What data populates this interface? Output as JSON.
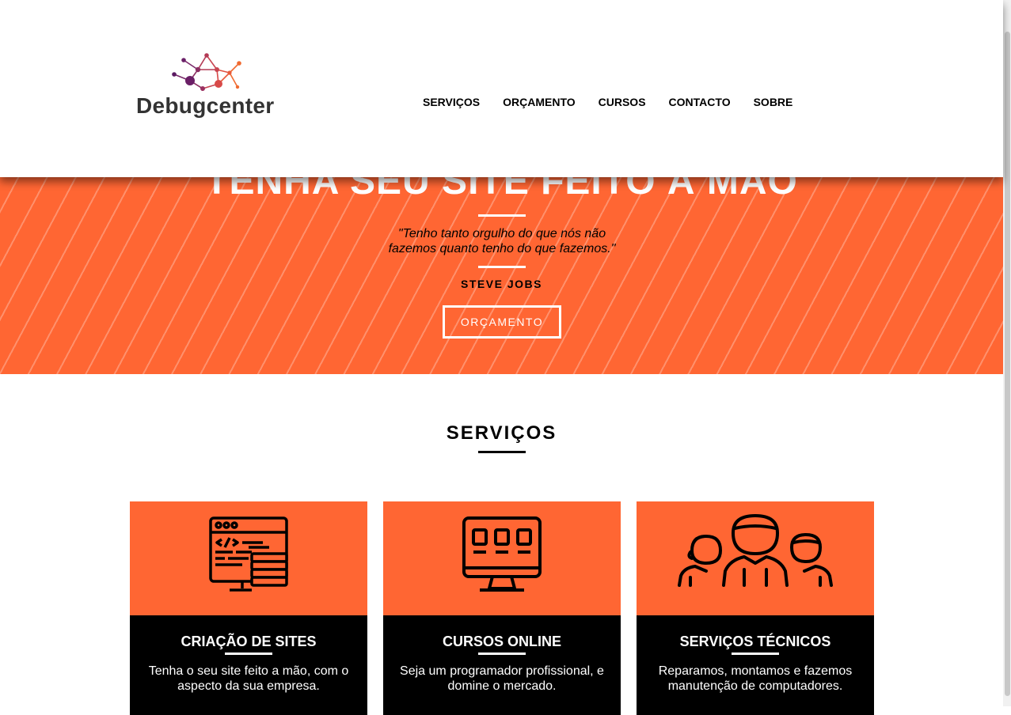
{
  "header": {
    "logo_text": "Debugcenter",
    "nav": [
      "SERVIÇOS",
      "ORÇAMENTO",
      "CURSOS",
      "CONTACTO",
      "SOBRE"
    ]
  },
  "hero": {
    "title": "TENHA SEU SITE FEITO À MÃO",
    "quote_line1": "\"Tenho tanto orgulho do que nós não",
    "quote_line2": "fazemos quanto tenho do que fazemos.\"",
    "author": "STEVE JOBS",
    "button_label": "ORÇAMENTO"
  },
  "services": {
    "title": "SERVIÇOS",
    "cards": [
      {
        "icon": "web-code-icon",
        "title": "CRIAÇÃO DE SITES",
        "text_line1": "Tenha o seu site feito a mão, com o",
        "text_line2": "aspecto da sua empresa."
      },
      {
        "icon": "monitor-icon",
        "title": "CURSOS ONLINE",
        "text_line1": "Seja um programador profissional, e",
        "text_line2": "domine o mercado."
      },
      {
        "icon": "team-icon",
        "title": "SERVIÇOS TÉCNICOS",
        "text_line1": "Reparamos, montamos e fazemos",
        "text_line2": "manutenção de computadores."
      }
    ]
  },
  "colors": {
    "accent": "#ff6633",
    "dark": "#000000",
    "logo_text": "#333333"
  }
}
